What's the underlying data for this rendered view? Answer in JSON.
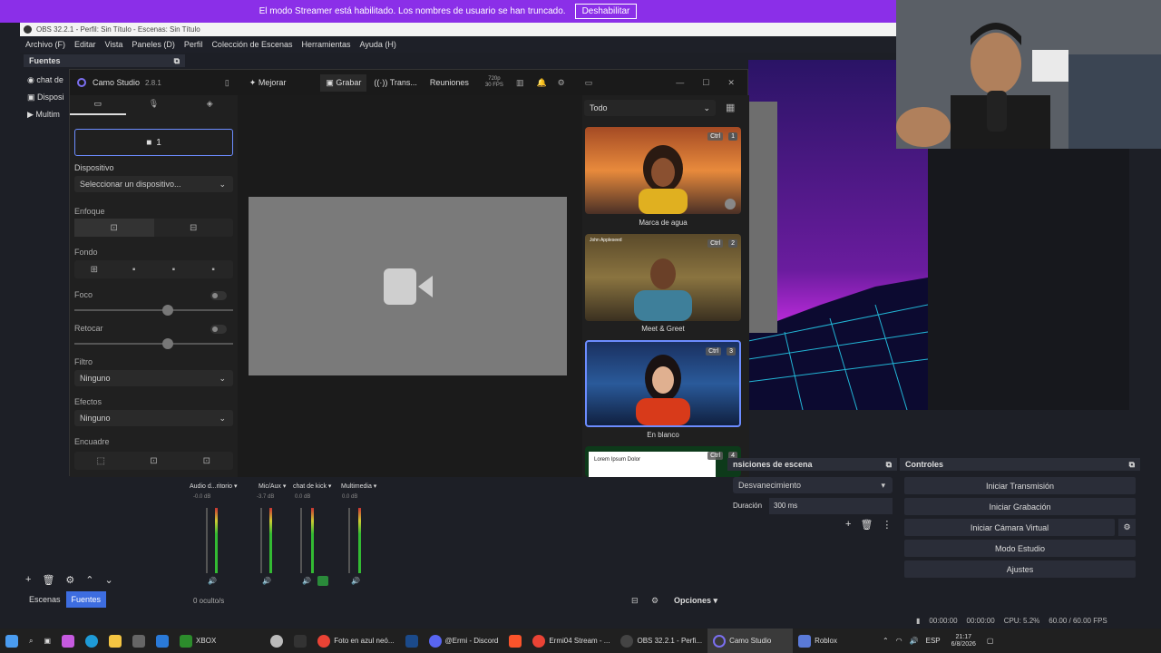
{
  "banner": {
    "text": "El modo Streamer está habilitado. Los nombres de usuario se han truncado.",
    "button": "Deshabilitar"
  },
  "obs": {
    "title": "OBS 32.2.1 - Perfil: Sin Título - Escenas: Sin Título",
    "menu": [
      "Archivo (F)",
      "Editar",
      "Vista",
      "Paneles (D)",
      "Perfil",
      "Colección de Escenas",
      "Herramientas",
      "Ayuda (H)"
    ],
    "sources_title": "Fuentes",
    "sources": [
      "chat de",
      "Disposi",
      "Multim"
    ],
    "tabs": [
      "Escenas",
      "Fuentes"
    ],
    "hidden": "0 oculto/s",
    "options": "Opciones",
    "transitions_title": "nsiciones de escena",
    "transition": "Desvanecimiento",
    "duration_label": "Duración",
    "duration_value": "300 ms",
    "controls_title": "Controles",
    "controls": [
      "Iniciar Transmisión",
      "Iniciar Grabación",
      "Iniciar Cámara Virtual",
      "Modo Estudio",
      "Ajustes"
    ],
    "mixer": [
      {
        "name": "Audio d...ritorio",
        "db": "-0.0 dB"
      },
      {
        "name": "Mic/Aux",
        "db": "-3.7 dB"
      },
      {
        "name": "chat de kick",
        "db": "0.0 dB"
      },
      {
        "name": "Multimedia",
        "db": "0.0 dB"
      }
    ],
    "status": {
      "t1": "00:00:00",
      "t2": "00:00:00",
      "cpu": "CPU: 5.2%",
      "fps": "60.00 / 60.00 FPS"
    }
  },
  "camo": {
    "app": "Camo Studio",
    "version": "2.8.1",
    "toolbar": {
      "improve": "Mejorar",
      "record": "Grabar",
      "stream": "Trans...",
      "meetings": "Reuniones",
      "res": "720p",
      "fps": "30 FPS"
    },
    "camera_label": "1",
    "device_label": "Dispositivo",
    "device_value": "Seleccionar un dispositivo...",
    "focus_label": "Enfoque",
    "background_label": "Fondo",
    "foco_label": "Foco",
    "retouch_label": "Retocar",
    "filter_label": "Filtro",
    "filter_value": "Ninguno",
    "effects_label": "Efectos",
    "effects_value": "Ninguno",
    "frame_label": "Encuadre",
    "filter_all": "Todo",
    "scenes": [
      {
        "name": "Marca de agua",
        "key": "Ctrl",
        "num": "1"
      },
      {
        "name": "Meet & Greet",
        "key": "Ctrl",
        "num": "2",
        "badge": "John Appleseed"
      },
      {
        "name": "En blanco",
        "key": "Ctrl",
        "num": "3"
      },
      {
        "name": "",
        "key": "Ctrl",
        "num": "4",
        "text": "Lorem Ipsum Dolor"
      }
    ]
  },
  "taskbar": {
    "apps": [
      "XBOX",
      "Foto en azul neó...",
      "@Ermi - Discord",
      "Ermi04 Stream - ...",
      "OBS 32.2.1 - Perfi...",
      "Camo Studio",
      "Roblox"
    ],
    "lang": "ESP",
    "time": "21:17",
    "date": "6/8/2026"
  }
}
